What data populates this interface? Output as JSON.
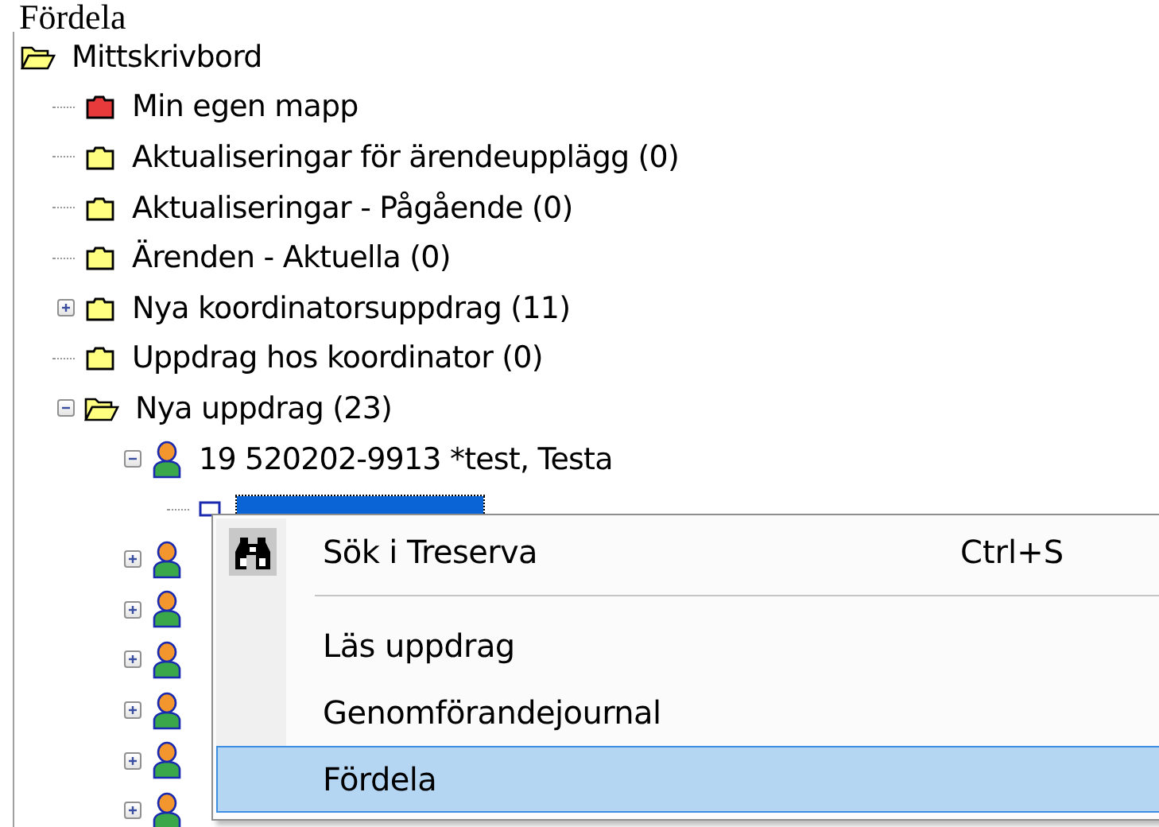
{
  "heading": "Fördela",
  "tree": [
    {
      "label": "Mittskrivbord",
      "kind": "folder",
      "color": "#ffff80",
      "expanded": true,
      "children": [
        {
          "label": "Min egen mapp",
          "kind": "folder",
          "color": "#e83a3a"
        },
        {
          "label": "Aktualiseringar för ärendeupplägg (0)",
          "kind": "folder",
          "color": "#ffff80"
        },
        {
          "label": "Aktualiseringar - Pågående (0)",
          "kind": "folder",
          "color": "#ffff80"
        },
        {
          "label": "Ärenden - Aktuella (0)",
          "kind": "folder",
          "color": "#ffff80"
        },
        {
          "label": "Nya koordinatorsuppdrag (11)",
          "kind": "folder",
          "color": "#ffff80",
          "expanded": false
        },
        {
          "label": "Uppdrag hos koordinator (0)",
          "kind": "folder",
          "color": "#ffff80"
        },
        {
          "label": "Nya uppdrag (23)",
          "kind": "folder",
          "color": "#ffff80",
          "expanded": true,
          "children": [
            {
              "label": "19 520202-9913  *test, Testa",
              "kind": "person",
              "expanded": true,
              "selected": false,
              "children": [
                {
                  "kind": "document",
                  "selected": true
                }
              ]
            },
            {
              "kind": "person",
              "expanded": false,
              "selected": false
            },
            {
              "kind": "person",
              "expanded": false,
              "selected": false
            },
            {
              "kind": "person",
              "expanded": false,
              "selected": false
            },
            {
              "kind": "person",
              "expanded": false,
              "selected": false
            },
            {
              "kind": "person",
              "expanded": false,
              "selected": false
            },
            {
              "kind": "person",
              "expanded": false,
              "selected": false
            }
          ]
        }
      ]
    }
  ],
  "context_menu": [
    {
      "kind": "item",
      "label": "Sök i Treserva",
      "shortcut": "Ctrl+S",
      "selected": false
    },
    {
      "kind": "separator"
    },
    {
      "kind": "item",
      "label": "Läs uppdrag",
      "selected": false
    },
    {
      "kind": "item",
      "label": "Genomförandejournal",
      "selected": false
    },
    {
      "kind": "item",
      "label": "Fördela",
      "selected": true
    }
  ]
}
